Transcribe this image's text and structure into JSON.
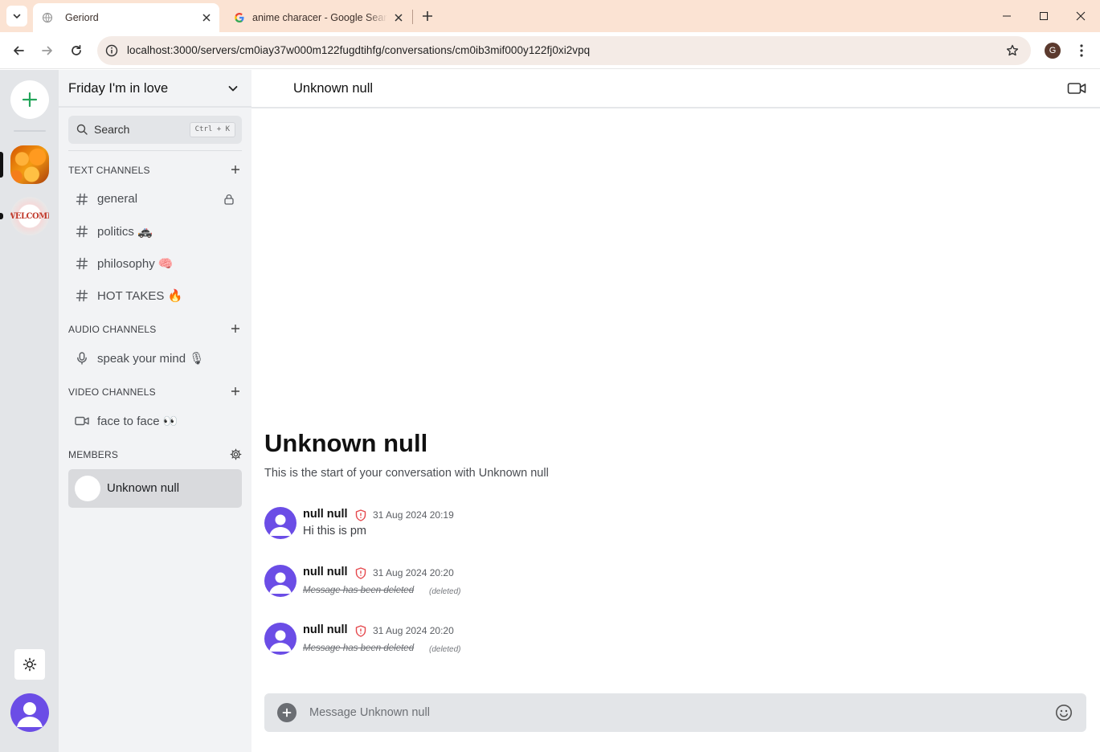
{
  "browser": {
    "tabs": [
      {
        "title": "Geriord",
        "active": true
      },
      {
        "title": "anime characer - Google Search",
        "active": false
      }
    ],
    "url": "localhost:3000/servers/cm0iay37w000m122fugdtihfg/conversations/cm0ib3mif000y122fj0xi2vpq",
    "profile_initial": "G"
  },
  "server": {
    "name": "Friday I'm in love",
    "search_label": "Search",
    "search_shortcut": "Ctrl + K"
  },
  "sections": {
    "text": "TEXT CHANNELS",
    "audio": "AUDIO CHANNELS",
    "video": "VIDEO CHANNELS",
    "members": "MEMBERS"
  },
  "text_channels": [
    {
      "name": "general",
      "locked": true
    },
    {
      "name": "politics 🚓"
    },
    {
      "name": "philosophy 🧠"
    },
    {
      "name": "HOT TAKES 🔥"
    }
  ],
  "audio_channels": [
    {
      "name": "speak your mind 🎙"
    }
  ],
  "video_channels": [
    {
      "name": "face to face 👀"
    }
  ],
  "members": [
    {
      "name": "Unknown null"
    }
  ],
  "conversation": {
    "header": "Unknown null",
    "welcome_title": "Unknown null",
    "welcome_sub": "This is the start of your conversation with Unknown null",
    "messages": [
      {
        "author": "null null",
        "time": "31 Aug 2024 20:19",
        "text": "Hi this is pm",
        "deleted": false
      },
      {
        "author": "null null",
        "time": "31 Aug 2024 20:20",
        "text": "Message has been deleted",
        "deleted": true,
        "deleted_tag": "(deleted)"
      },
      {
        "author": "null null",
        "time": "31 Aug 2024 20:20",
        "text": "Message has been deleted",
        "deleted": true,
        "deleted_tag": "(deleted)"
      }
    ],
    "composer_placeholder": "Message Unknown null"
  },
  "colors": {
    "accent_green": "#23a55a",
    "avatar_purple": "#6b4de6",
    "mod_shield_red": "#e5484d"
  }
}
